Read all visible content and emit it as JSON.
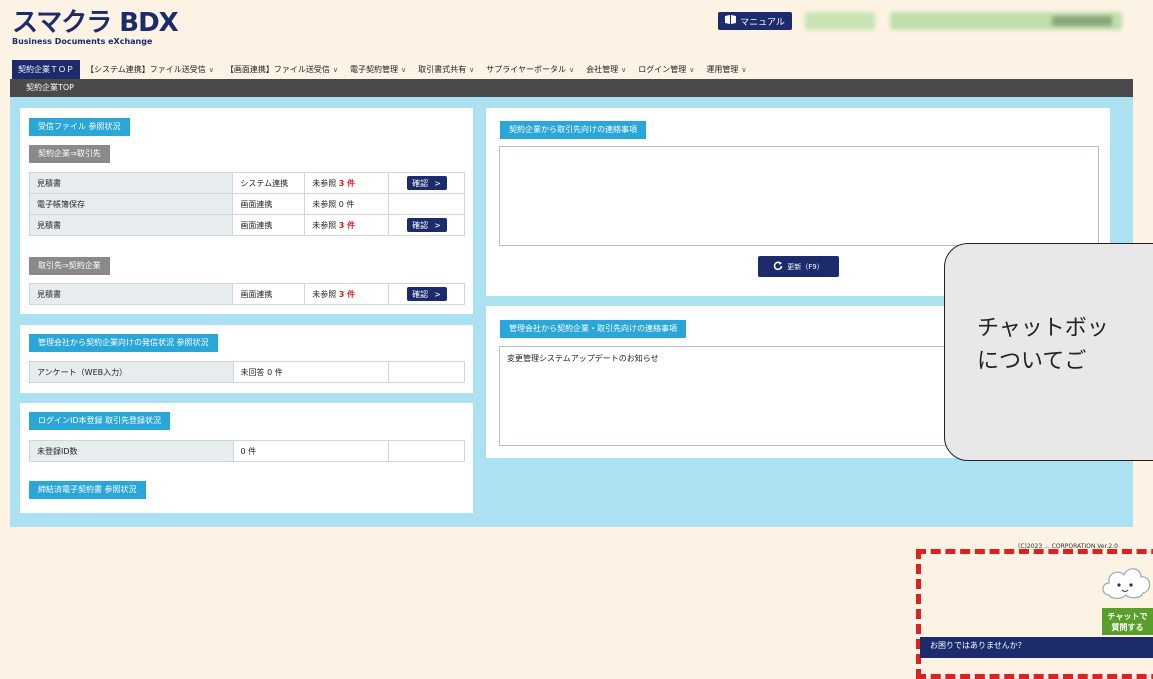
{
  "header": {
    "logo_main": "スマクラ BDX",
    "logo_sub": "Business Documents eXchange",
    "manual_label": "マニュアル",
    "manual_icon": "book-icon"
  },
  "nav": {
    "items": [
      {
        "label": "契約企業ＴＯＰ",
        "dropdown": false,
        "active": true
      },
      {
        "label": "【システム連携】ファイル送受信",
        "dropdown": true
      },
      {
        "label": "【画面連携】ファイル送受信",
        "dropdown": true
      },
      {
        "label": "電子契約管理",
        "dropdown": true
      },
      {
        "label": "取引書式共有",
        "dropdown": true
      },
      {
        "label": "サプライヤーポータル",
        "dropdown": true
      },
      {
        "label": "会社管理",
        "dropdown": true
      },
      {
        "label": "ログイン管理",
        "dropdown": true
      },
      {
        "label": "運用管理",
        "dropdown": true
      }
    ],
    "breadcrumb": "契約企業TOP"
  },
  "received": {
    "tag": "受信ファイル 参照状況",
    "section1_label": "契約企業⇒取引先",
    "rows1": [
      {
        "doc": "見積書",
        "type": "システム連携",
        "status_prefix": "未参照",
        "count": "3 件",
        "highlight": true,
        "button": "確認"
      },
      {
        "doc": "電子帳簿保存",
        "type": "画面連携",
        "status_prefix": "未参照",
        "count": "0 件",
        "highlight": false,
        "button": ""
      },
      {
        "doc": "見積書",
        "type": "画面連携",
        "status_prefix": "未参照",
        "count": "3 件",
        "highlight": true,
        "button": "確認"
      }
    ],
    "section2_label": "取引先⇒契約企業",
    "rows2": [
      {
        "doc": "見積書",
        "type": "画面連携",
        "status_prefix": "未参照",
        "count": "3 件",
        "highlight": true,
        "button": "確認"
      }
    ]
  },
  "mgmt_status": {
    "tag": "管理会社から契約企業向けの発信状況 参照状況",
    "row": {
      "label": "アンケート（WEB入力）",
      "value": "未回答 0 件"
    }
  },
  "login_status": {
    "tag": "ログインID本登録 取引先登録状況",
    "row": {
      "label": "未登録ID数",
      "value": "0 件"
    }
  },
  "signed_contracts": {
    "tag": "締結済電子契約書 参照状況"
  },
  "notice_to_partners": {
    "tag": "契約企業から取引先向けの連絡事項",
    "content": "",
    "update_label": "更新（F9）",
    "update_icon": "refresh-icon"
  },
  "notice_from_mgmt": {
    "tag": "管理会社から契約企業・取引先向けの連絡事項",
    "content": "変更管理システムアップデートのお知らせ"
  },
  "footer": {
    "copyright": "(C)2023 ... CORPORATION Ver.2.0"
  },
  "overlay": {
    "text": "チャットボッ\nについてご"
  },
  "chat_widget": {
    "label": "チャットで\n質問する",
    "bar_text": "お困りではありませんか？",
    "icon": "chat-cloud-icon"
  },
  "colors": {
    "brand_navy": "#1b2b6b",
    "accent_blue": "#2aa6d9",
    "main_bg": "#abe1f0",
    "alert_red": "#e02020",
    "chat_green": "#5a9f2b"
  }
}
